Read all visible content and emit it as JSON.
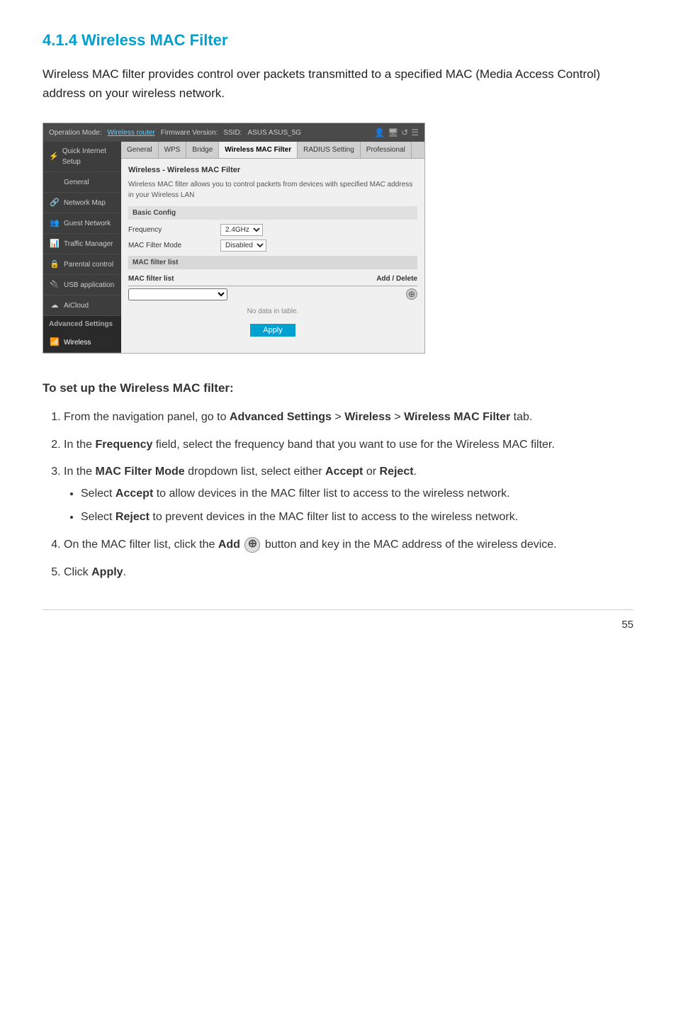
{
  "page": {
    "title": "4.1.4 Wireless MAC Filter",
    "intro": "Wireless MAC filter provides control over packets transmitted to a specified MAC (Media Access Control) address on your wireless network.",
    "page_number": "55"
  },
  "router_ui": {
    "top_bar": {
      "operation_mode_label": "Operation Mode:",
      "operation_mode_value": "Wireless router",
      "firmware_label": "Firmware Version:",
      "ssid_label": "SSID:",
      "ssid_value": "ASUS  ASUS_5G"
    },
    "tabs": [
      "General",
      "WPS",
      "Bridge",
      "Wireless MAC Filter",
      "RADIUS Setting",
      "Professional"
    ],
    "active_tab": "Wireless MAC Filter",
    "section_title": "Wireless - Wireless MAC Filter",
    "description": "Wireless MAC filter allows you to control packets from devices with specified MAC address in your Wireless LAN",
    "basic_config_label": "Basic Config",
    "frequency_label": "Frequency",
    "frequency_value": "2.4GHz",
    "mac_filter_mode_label": "MAC Filter Mode",
    "mac_filter_mode_value": "Disabled",
    "mac_filter_list_label": "MAC filter list",
    "mac_filter_list_header": "MAC filter list",
    "add_delete_label": "Add / Delete",
    "no_data_label": "No data in table.",
    "apply_label": "Apply"
  },
  "sidebar": {
    "items": [
      {
        "id": "quick-internet-setup",
        "label": "Quick Internet Setup",
        "icon": "⚡"
      },
      {
        "id": "general",
        "label": "General",
        "icon": ""
      },
      {
        "id": "network-map",
        "label": "Network Map",
        "icon": "🔗"
      },
      {
        "id": "guest-network",
        "label": "Guest Network",
        "icon": "👥"
      },
      {
        "id": "traffic-manager",
        "label": "Traffic Manager",
        "icon": "📊"
      },
      {
        "id": "parental-control",
        "label": "Parental control",
        "icon": "🔒"
      },
      {
        "id": "usb-application",
        "label": "USB application",
        "icon": "🔌"
      },
      {
        "id": "aicloud",
        "label": "AiCloud",
        "icon": "☁"
      }
    ],
    "advanced_settings_label": "Advanced Settings",
    "wireless_label": "Wireless"
  },
  "instructions": {
    "title": "To set up the Wireless MAC filter:",
    "steps": [
      {
        "text_parts": [
          "From the navigation panel, go to ",
          "Advanced Settings",
          " > ",
          "Wireless",
          " > ",
          "Wireless MAC Filter",
          " tab."
        ]
      },
      {
        "text_parts": [
          "In the ",
          "Frequency",
          " field, select the frequency band that you want to use for the Wireless MAC filter."
        ]
      },
      {
        "text_parts": [
          "In the ",
          "MAC Filter Mode",
          " dropdown list, select either ",
          "Accept",
          " or ",
          "Reject",
          "."
        ],
        "bullets": [
          {
            "text_parts": [
              "Select ",
              "Accept",
              " to allow devices in the MAC filter list to access to the wireless network."
            ]
          },
          {
            "text_parts": [
              "Select ",
              "Reject",
              " to prevent devices in the MAC filter list to access to the wireless network."
            ]
          }
        ]
      },
      {
        "text_parts": [
          "On the MAC filter list, click the ",
          "Add",
          " button and key in the MAC address of the wireless device."
        ]
      },
      {
        "text_parts": [
          "Click ",
          "Apply",
          "."
        ]
      }
    ]
  }
}
